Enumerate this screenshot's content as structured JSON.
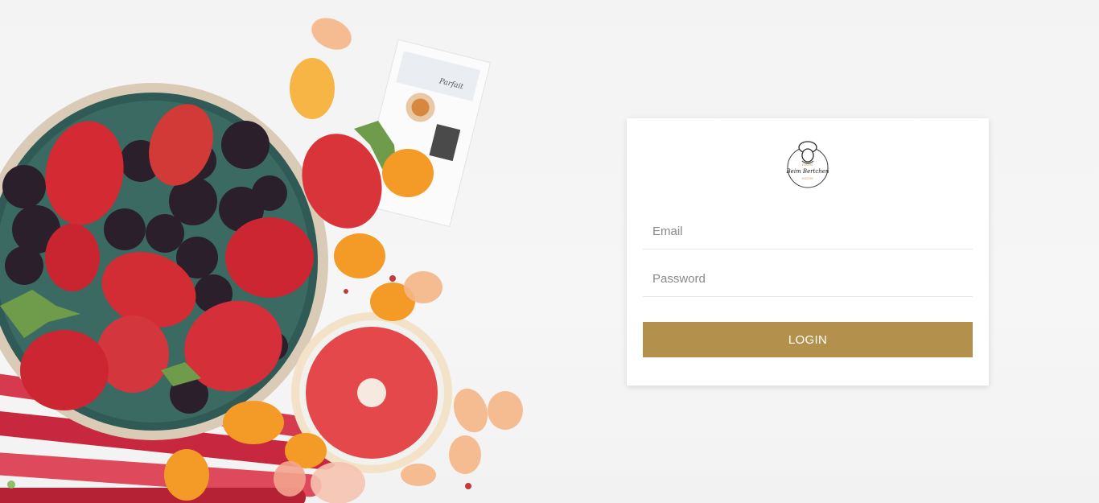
{
  "brand": {
    "logo_top_text": "KÜCHE",
    "logo_name": "Beim Bertchen",
    "logo_bottom_text": "KÜCHE"
  },
  "recipe_card": {
    "title": "Parfait"
  },
  "login": {
    "email_placeholder": "Email",
    "password_placeholder": "Password",
    "submit_label": "LOGIN"
  },
  "colors": {
    "accent": "#b4904d",
    "card_background": "#ffffff",
    "page_background": "#f4f4f4"
  }
}
